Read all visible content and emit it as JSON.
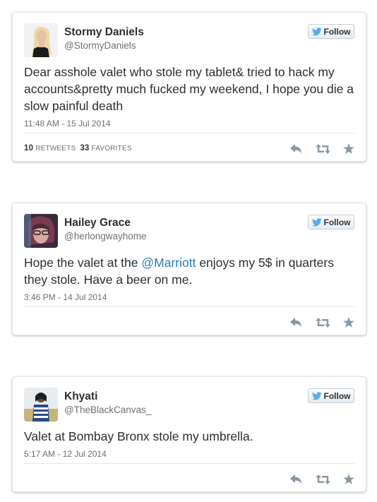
{
  "follow_label": "Follow",
  "tweets": [
    {
      "name": "Stormy Daniels",
      "handle": "@StormyDaniels",
      "text": "Dear asshole valet who stole my tablet& tried to hack my accounts&pretty much fucked my weekend, I hope you die a slow painful death",
      "date": "11:48 AM - 15 Jul 2014",
      "retweets": "10",
      "retweets_label": "RETWEETS",
      "favorites": "33",
      "favorites_label": "FAVORITES"
    },
    {
      "name": "Hailey Grace",
      "handle": "@herlongwayhome",
      "text_before": "Hope the valet at the ",
      "mention": "@Marriott",
      "text_after": " enjoys my 5$ in quarters they stole. Have a beer on me.",
      "date": "3:46 PM - 14 Jul 2014"
    },
    {
      "name": "Khyati",
      "handle": "@TheBlackCanvas_",
      "text": "Valet at Bombay Bronx stole my umbrella.",
      "date": "5:17 AM - 12 Jul 2014"
    }
  ],
  "icons": {
    "follow": "twitter-bird-icon",
    "reply": "reply-icon",
    "retweet": "retweet-icon",
    "favorite": "star-icon"
  },
  "colors": {
    "twitter_blue": "#55acee",
    "mention": "#2b7bb9",
    "icon_gray": "#8899a6"
  }
}
